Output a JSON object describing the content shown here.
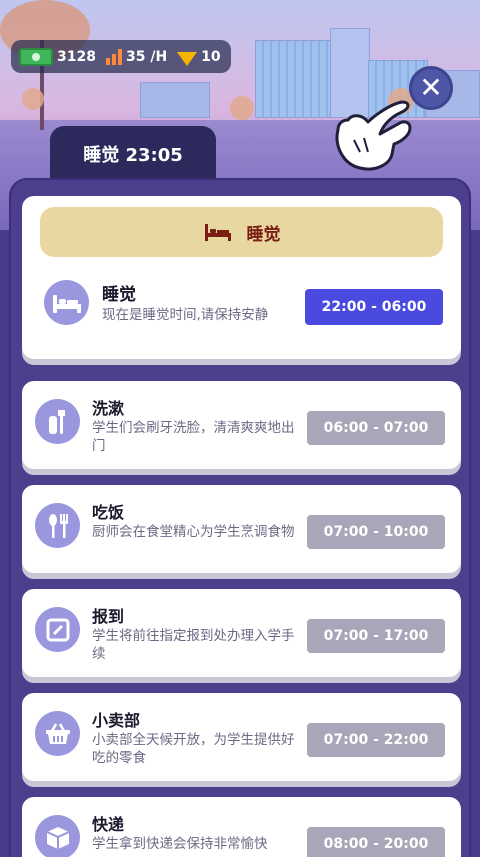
{
  "resources": {
    "cash": "3128",
    "income": "35 /H",
    "gems": "10"
  },
  "header": {
    "tab_label": "睡觉 23:05",
    "close_glyph": "✕"
  },
  "current": {
    "banner_label": "睡觉",
    "title": "睡觉",
    "desc": "现在是睡觉时间,请保持安静",
    "time": "22:00 - 06:00"
  },
  "schedule": [
    {
      "title": "洗漱",
      "desc": "学生们会刷牙洗脸，清清爽爽地出门",
      "time": "06:00 - 07:00",
      "icon": "toothbrush-icon"
    },
    {
      "title": "吃饭",
      "desc": "厨师会在食堂精心为学生烹调食物",
      "time": "07:00 - 10:00",
      "icon": "utensils-icon"
    },
    {
      "title": "报到",
      "desc": "学生将前往指定报到处办理入学手续",
      "time": "07:00 - 17:00",
      "icon": "edit-note-icon"
    },
    {
      "title": "小卖部",
      "desc": "小卖部全天候开放，为学生提供好吃的零食",
      "time": "07:00 - 22:00",
      "icon": "basket-icon"
    },
    {
      "title": "快递",
      "desc": "学生拿到快递会保持非常愉快",
      "time": "08:00 - 20:00",
      "icon": "package-icon"
    }
  ],
  "colors": {
    "panel": "#4b3f8e",
    "active_time": "#4a4ae0",
    "inactive_time": "#a8a6b8",
    "banner": "#e9d7a1",
    "banner_text": "#7a1d12"
  }
}
